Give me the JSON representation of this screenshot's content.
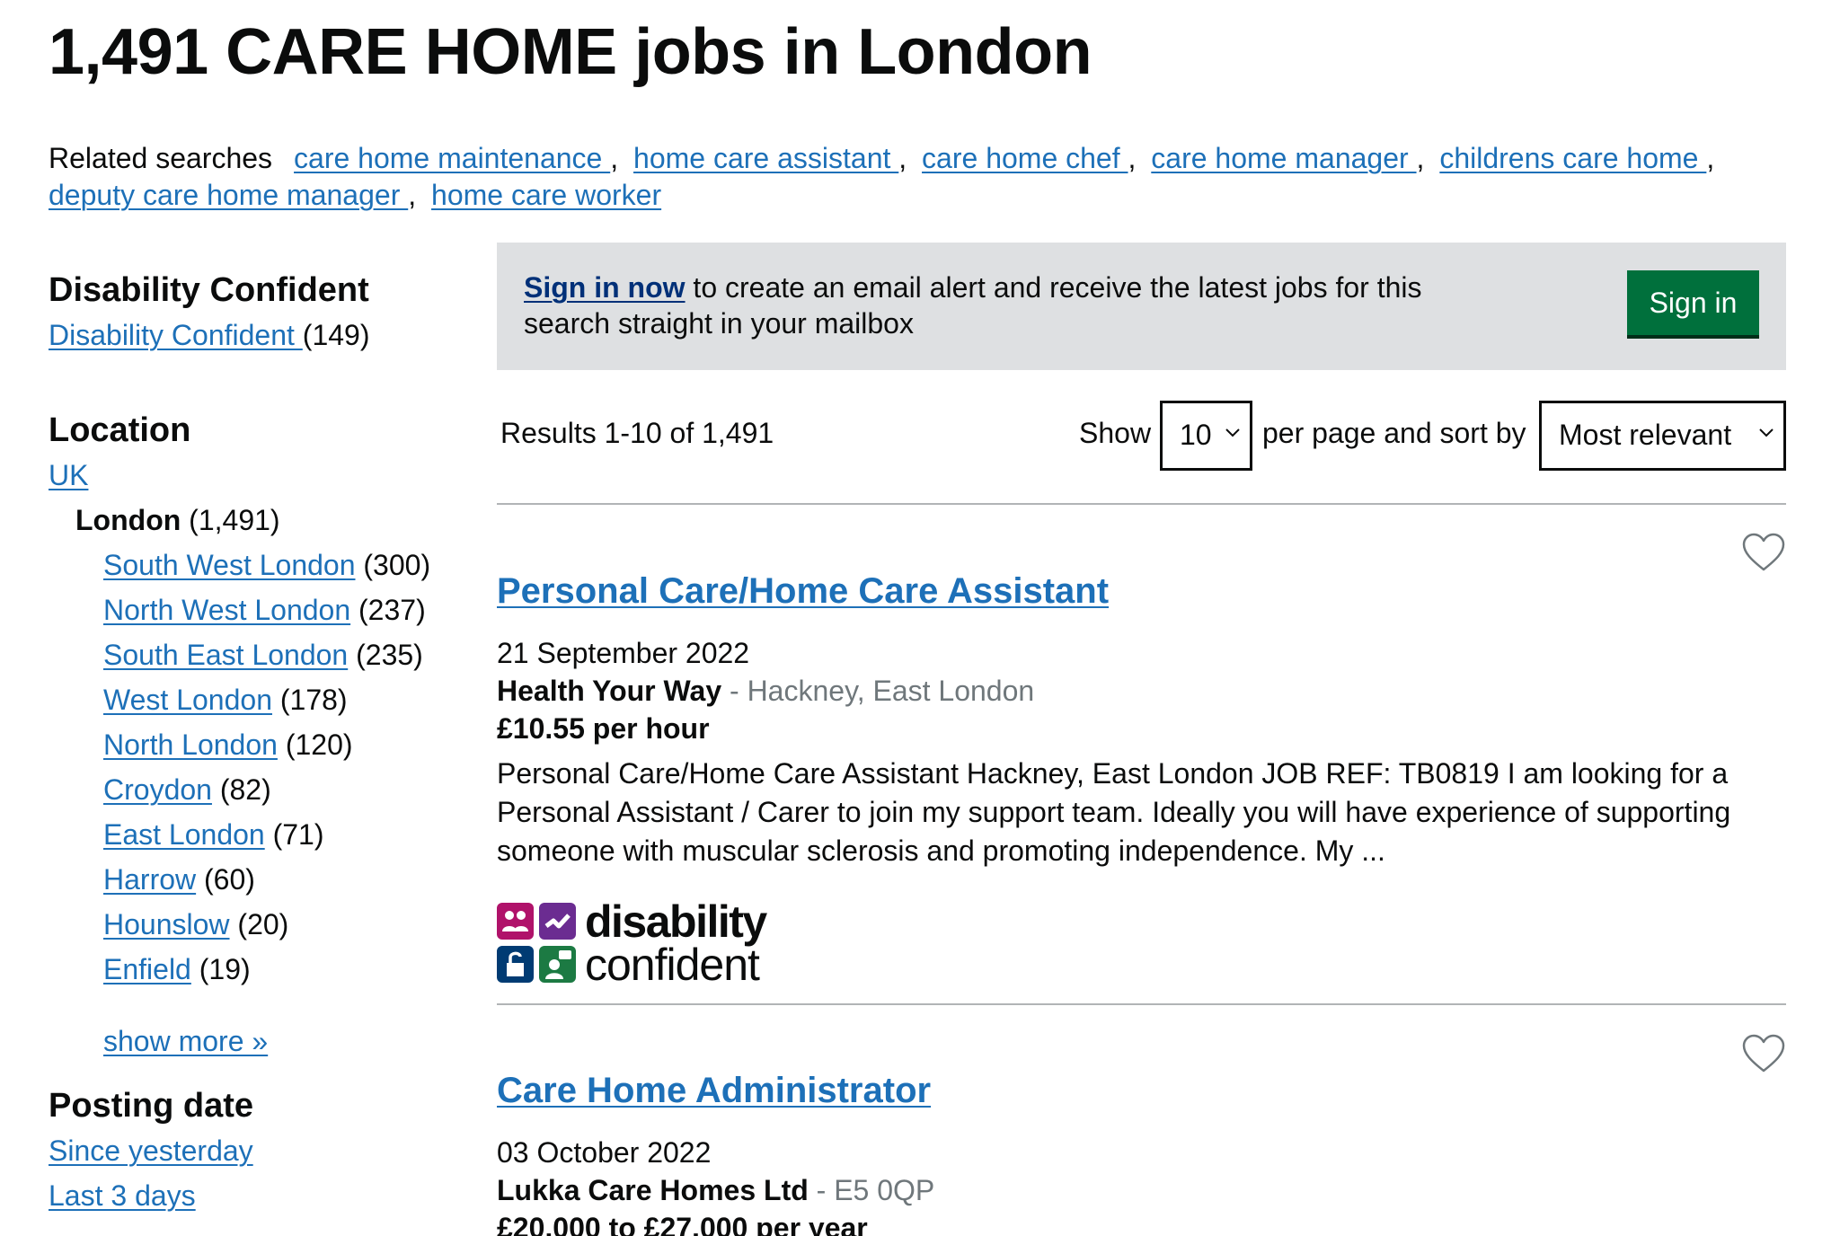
{
  "page_title": "1,491 CARE HOME jobs in London",
  "related": {
    "label": "Related searches",
    "links": [
      "care home maintenance ",
      "home care assistant ",
      "care home chef ",
      "care home manager ",
      "childrens care home ",
      "deputy care home manager ",
      "home care worker"
    ]
  },
  "sidebar": {
    "disability": {
      "heading": "Disability Confident",
      "link": "Disability Confident ",
      "count": "(149)"
    },
    "location": {
      "heading": "Location",
      "uk": "UK",
      "current": {
        "label": "London",
        "count": "(1,491)"
      },
      "items": [
        {
          "label": "South West London",
          "count": "(300)"
        },
        {
          "label": "North West London",
          "count": "(237)"
        },
        {
          "label": "South East London",
          "count": "(235)"
        },
        {
          "label": "West London",
          "count": "(178)"
        },
        {
          "label": "North London",
          "count": "(120)"
        },
        {
          "label": "Croydon",
          "count": "(82)"
        },
        {
          "label": "East London",
          "count": "(71)"
        },
        {
          "label": "Harrow",
          "count": "(60)"
        },
        {
          "label": "Hounslow",
          "count": "(20)"
        },
        {
          "label": "Enfield",
          "count": "(19)"
        }
      ],
      "show_more": "show more »"
    },
    "posting_date": {
      "heading": "Posting date",
      "items": [
        "Since yesterday",
        "Last 3 days"
      ]
    }
  },
  "signin_banner": {
    "link": "Sign in now",
    "text": " to create an email alert and receive the latest jobs for this search straight in your mailbox",
    "button": "Sign in"
  },
  "results": {
    "count_text": "Results 1-10 of 1,491",
    "show_label": "Show",
    "per_page": "10",
    "sort_label": "per page and sort by",
    "sort": "Most relevant"
  },
  "jobs": [
    {
      "title": "Personal Care/Home Care Assistant",
      "date": "21 September 2022",
      "company": "Health Your Way",
      "location": "Hackney, East London",
      "salary": "£10.55 per hour",
      "description": "Personal Care/Home Care Assistant Hackney, East London JOB REF: TB0819 I am looking for a Personal Assistant / Carer to join my support team. Ideally you will have experience of supporting someone with muscular sclerosis and promoting independence. My ...",
      "badge": {
        "line1": "disability",
        "line2": "confident"
      }
    },
    {
      "title": "Care Home Administrator",
      "date": "03 October 2022",
      "company": "Lukka Care Homes Ltd",
      "location": "E5 0QP",
      "salary": "£20,000 to £27,000 per year"
    }
  ],
  "separator": " - ",
  "colors": {
    "link": "#1d70b8",
    "banner_bg": "#dee0e2",
    "signin_button": "#00703c",
    "dc_pink": "#b0126a",
    "dc_purple": "#6b2c91",
    "dc_blue": "#003b73",
    "dc_green": "#1c7a43"
  }
}
